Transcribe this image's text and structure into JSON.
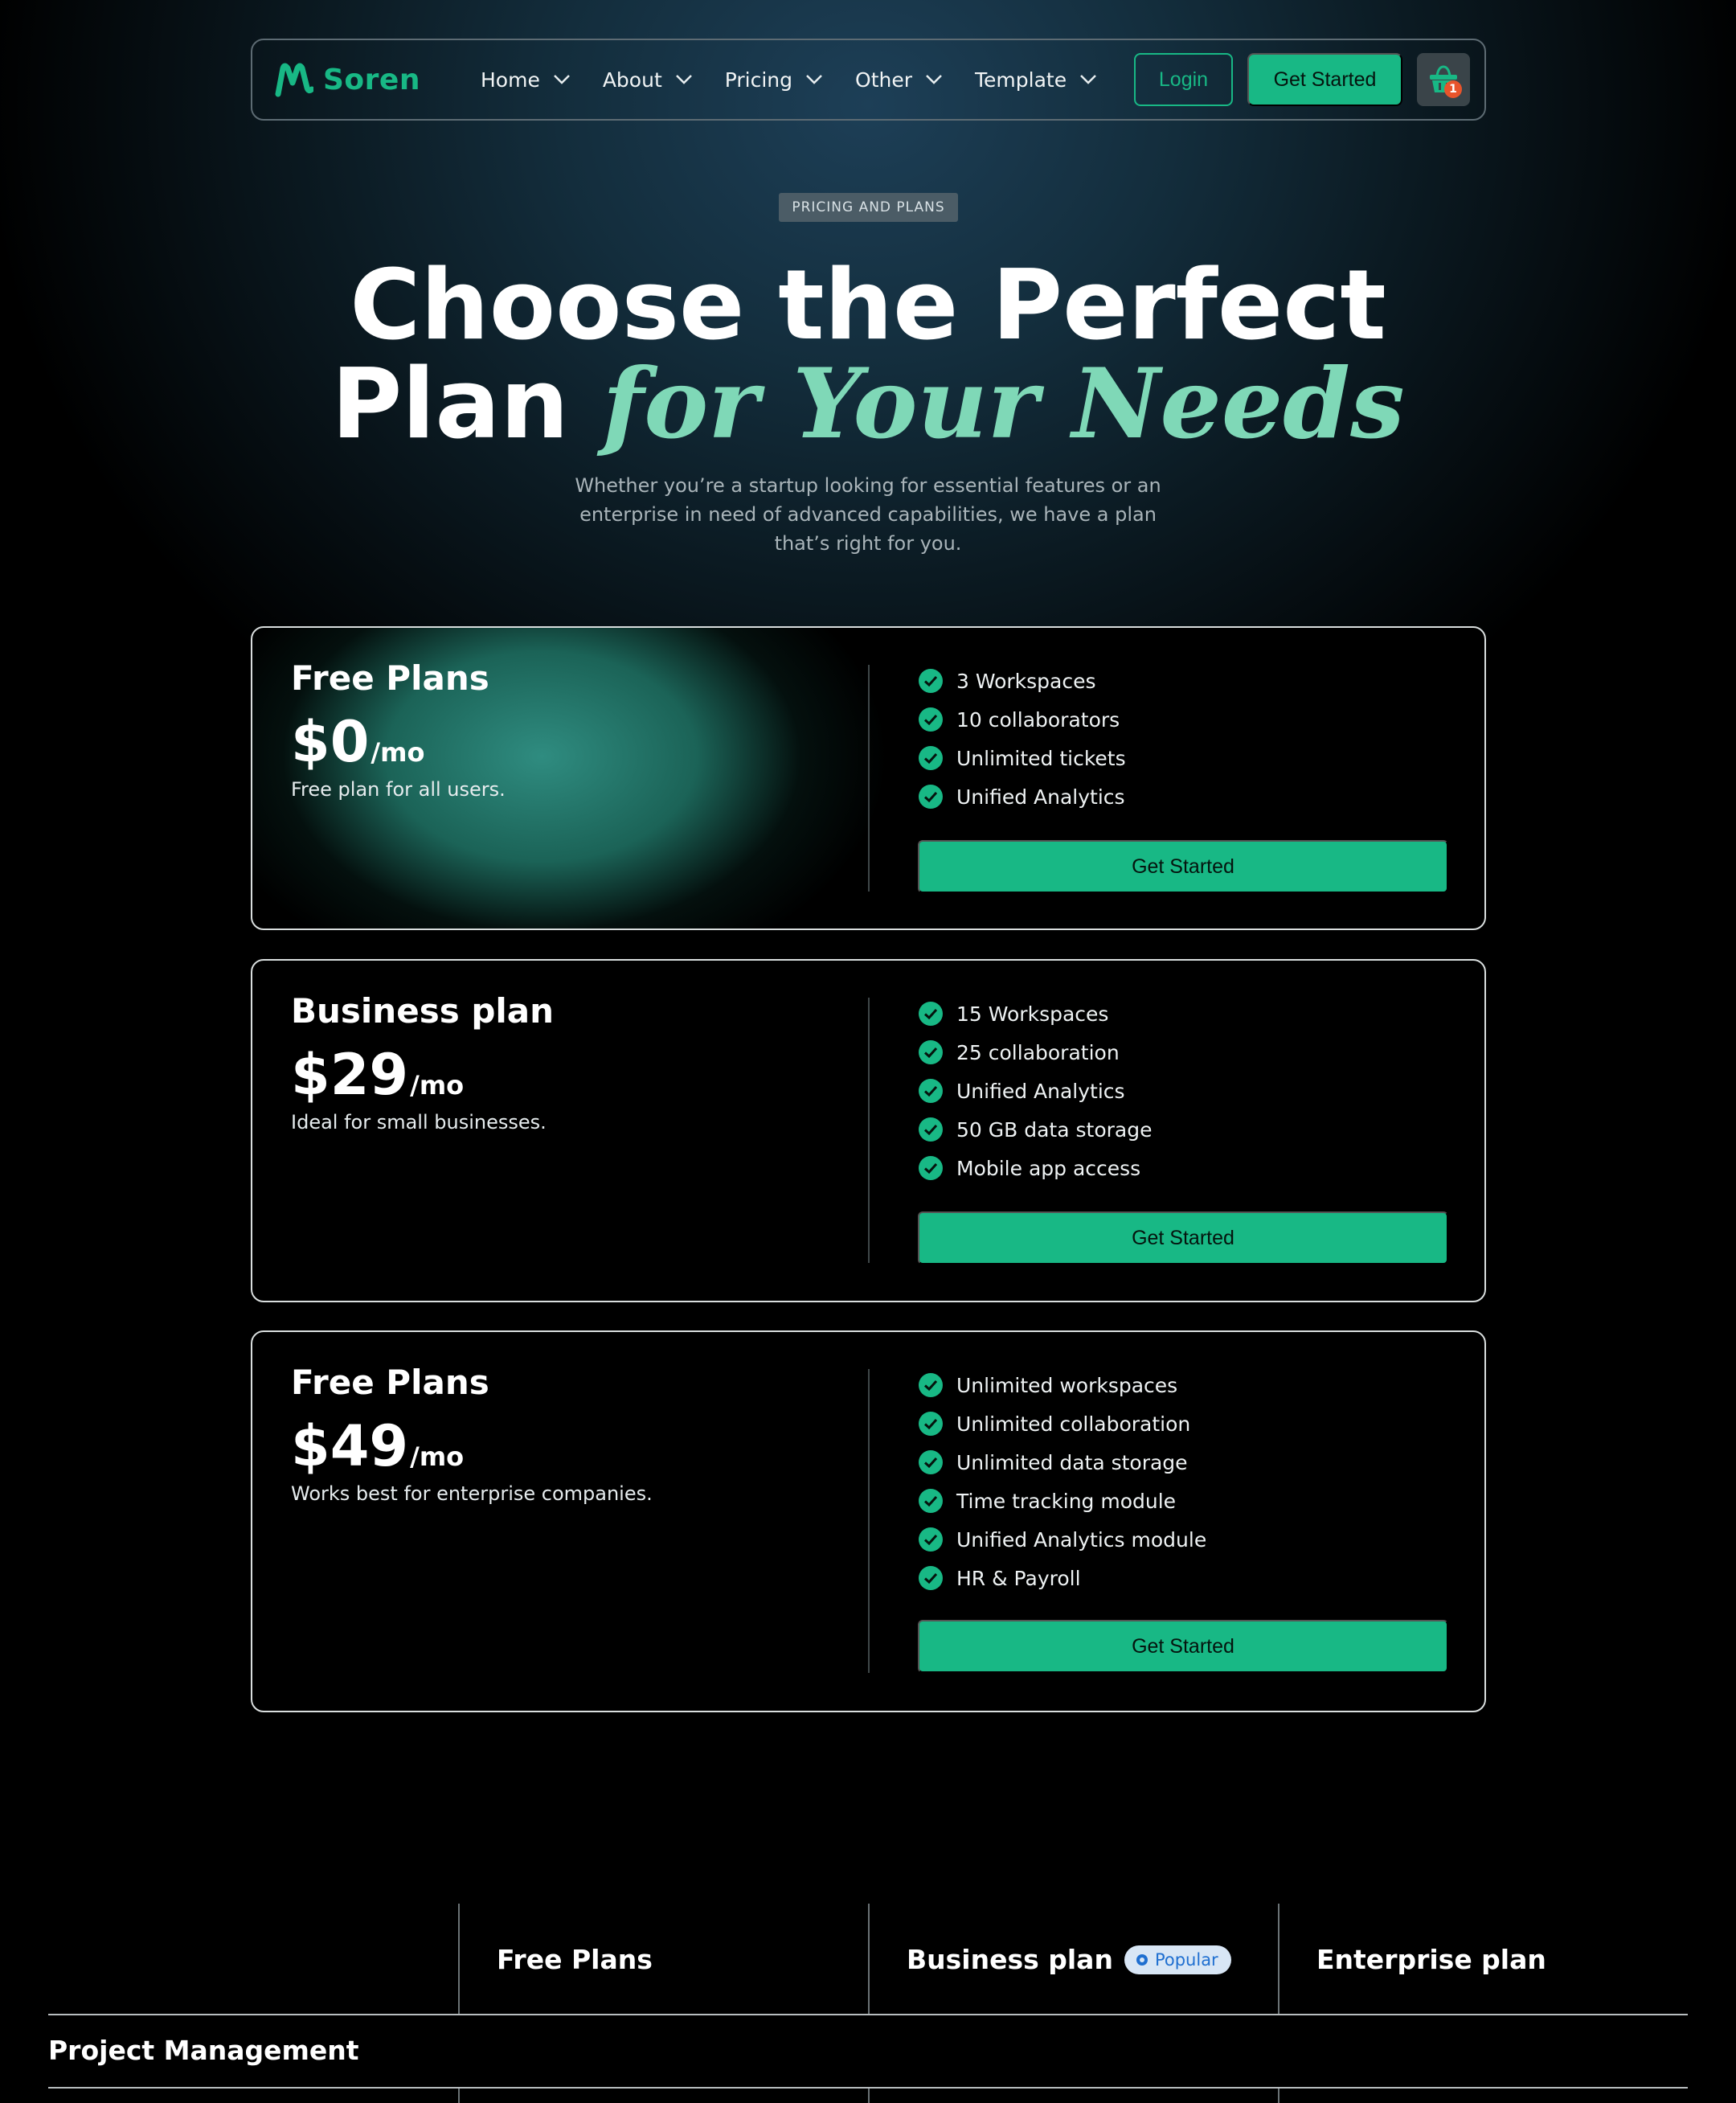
{
  "brand": {
    "name": "Soren",
    "accent": "#18b885"
  },
  "nav": {
    "items": [
      {
        "label": "Home"
      },
      {
        "label": "About"
      },
      {
        "label": "Pricing"
      },
      {
        "label": "Other"
      },
      {
        "label": "Template"
      }
    ],
    "login": "Login",
    "get_started": "Get Started",
    "cart_count": "1"
  },
  "hero": {
    "tag": "PRICING AND PLANS",
    "title_line1": "Choose the Perfect",
    "title_line2_plain": "Plan ",
    "title_line2_accent": "for Your Needs",
    "subtitle": "Whether you’re a startup looking for essential features or an enterprise in need of advanced capabilities, we have a plan that’s right for you."
  },
  "plans": [
    {
      "name": "Free Plans",
      "price": "$0",
      "period": "/mo",
      "description": "Free plan for all users.",
      "features": [
        "3 Workspaces",
        "10 collaborators",
        "Unlimited tickets",
        "Unified Analytics"
      ],
      "cta": "Get Started"
    },
    {
      "name": "Business plan",
      "price": "$29",
      "period": "/mo",
      "description": "Ideal for small businesses.",
      "features": [
        "15 Workspaces",
        "25 collaboration",
        "Unified Analytics",
        "50 GB data storage",
        "Mobile app access"
      ],
      "cta": "Get Started"
    },
    {
      "name": "Free Plans",
      "price": "$49",
      "period": "/mo",
      "description": "Works best for enterprise companies.",
      "features": [
        "Unlimited workspaces",
        "Unlimited collaboration",
        "Unlimited data storage",
        "Time tracking module",
        "Unified Analytics module",
        "HR & Payroll"
      ],
      "cta": "Get Started"
    }
  ],
  "comparison": {
    "columns": [
      {
        "title": "Free Plans"
      },
      {
        "title": "Business plan",
        "badge": "Popular"
      },
      {
        "title": "Enterprise plan"
      }
    ],
    "section": "Project Management"
  }
}
